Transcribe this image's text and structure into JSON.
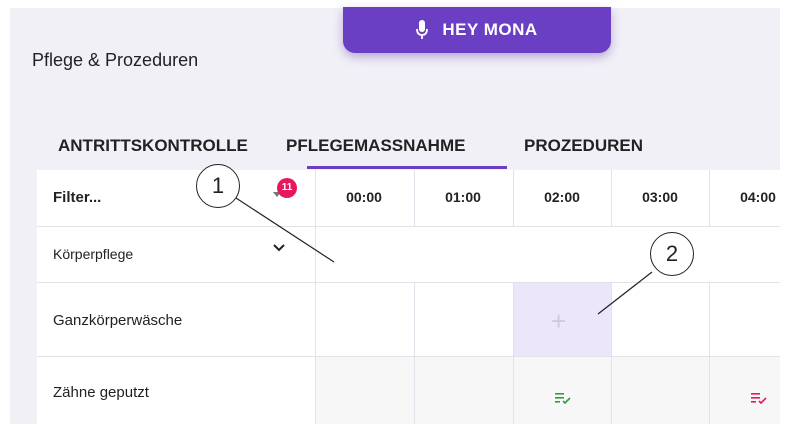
{
  "header": {
    "page_title": "Pflege & Prozeduren",
    "voice_button": {
      "label": "HEY MONA",
      "icon": "microphone-icon"
    }
  },
  "tabs": [
    {
      "label": "ANTRITTSKONTROLLE",
      "active": false
    },
    {
      "label": "PFLEGEMASSNAHME",
      "active": true
    },
    {
      "label": "PROZEDUREN",
      "active": false
    }
  ],
  "grid": {
    "filter": {
      "label": "Filter...",
      "badge_count": "11"
    },
    "hours": [
      "00:00",
      "01:00",
      "02:00",
      "03:00",
      "04:00"
    ],
    "group": {
      "label": "Körperpflege",
      "icon": "chevron-down-icon"
    },
    "rows": [
      {
        "label": "Ganzkörperwäsche",
        "add_slot_hour": "02:00",
        "add_icon": "plus-icon"
      },
      {
        "label": "Zähne geputzt",
        "entries": [
          {
            "hour": "02:00",
            "icon": "list-check-icon",
            "color": "#2e9e3a"
          },
          {
            "hour": "04:00",
            "icon": "list-check-icon",
            "color": "#e6175c"
          }
        ]
      }
    ]
  },
  "callouts": [
    "1",
    "2"
  ],
  "colors": {
    "accent": "#6b3fc4",
    "badge": "#e6175c",
    "done_ok": "#2e9e3a",
    "done_alert": "#e6175c"
  }
}
